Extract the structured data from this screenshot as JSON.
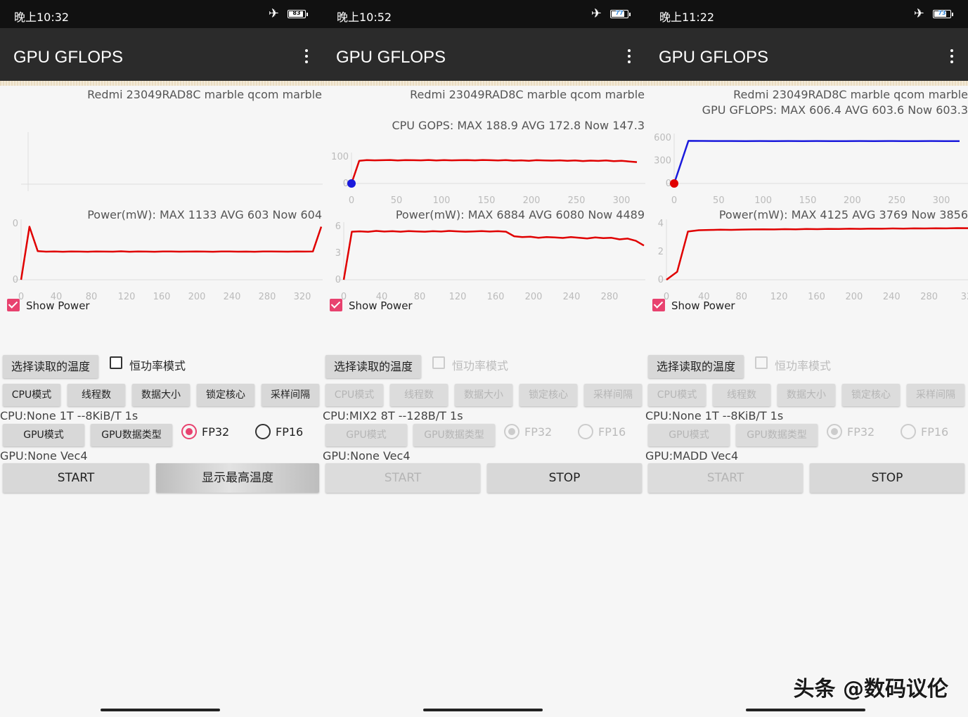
{
  "colors": {
    "accent": "#e8426f",
    "series": "#e00000",
    "gpu_series": "#1a1adc",
    "start_point": "#1a1adc"
  },
  "watermark": "头条 @数码议伦",
  "panels": [
    {
      "status_time": "晚上10:32",
      "battery": "83",
      "battery_level": 0.83,
      "charging": false,
      "title": "GPU GFLOPS",
      "device": "Redmi 23049RAD8C marble qcom marble",
      "perf_label": "",
      "perf_chart": {
        "type": "line",
        "y_ticks": [],
        "x_ticks": [],
        "values": []
      },
      "power_label": "Power(mW): MAX 1133 AVG 603 Now 604",
      "power_chart": {
        "type": "line",
        "y_ticks": [
          "0",
          "0"
        ],
        "x_ticks": [
          "0",
          "40",
          "80",
          "120",
          "160",
          "200",
          "240",
          "280",
          "320"
        ],
        "x_max": 340,
        "y_max": 1200,
        "values": [
          0,
          1133,
          610,
          600,
          603,
          598,
          605,
          601,
          599,
          604,
          602,
          600,
          607,
          598,
          603,
          601,
          599,
          605,
          603,
          600,
          602,
          604,
          601,
          599,
          603,
          605,
          600,
          602,
          598,
          604,
          603,
          601,
          600,
          605,
          602,
          604,
          1133
        ]
      },
      "show_power_label": "Show Power",
      "temp_button": "选择读取的温度",
      "const_power_label": "恒功率模式",
      "mode_buttons": [
        "CPU模式",
        "线程数",
        "数据大小",
        "锁定核心",
        "采样间隔"
      ],
      "cpu_info": "CPU:None 1T --8KiB/T 1s",
      "gpu_mode_button": "GPU模式",
      "gpu_type_button": "GPU数据类型",
      "fp32_label": "FP32",
      "fp16_label": "FP16",
      "gpu_info": "GPU:None Vec4",
      "start_button": "START",
      "second_button": "显示最高温度",
      "controls_disabled": false
    },
    {
      "status_time": "晚上10:52",
      "battery": "77",
      "battery_level": 0.77,
      "charging": true,
      "title": "GPU GFLOPS",
      "device": "Redmi 23049RAD8C marble qcom marble",
      "perf_label": "CPU GOPS: MAX 188.9 AVG 172.8 Now 147.3",
      "perf_chart": {
        "type": "line",
        "y_ticks": [
          "100",
          "0"
        ],
        "x_ticks": [
          "0",
          "50",
          "100",
          "150",
          "200",
          "250",
          "300"
        ],
        "x_max": 320,
        "y_max": 200,
        "values": [
          0,
          170,
          175,
          173,
          174,
          176,
          172,
          175,
          174,
          173,
          176,
          172,
          175,
          173,
          174,
          175,
          173,
          176,
          174,
          172,
          175,
          171,
          173,
          170,
          174,
          172,
          171,
          173,
          170,
          172,
          168,
          171,
          169,
          172,
          167,
          170,
          165,
          160
        ]
      },
      "power_label": "Power(mW): MAX 6884 AVG 6080 Now 4489",
      "power_chart": {
        "type": "line",
        "y_ticks": [
          "6",
          "3",
          "0"
        ],
        "x_ticks": [
          "0",
          "40",
          "80",
          "120",
          "160",
          "200",
          "240",
          "280"
        ],
        "x_max": 320,
        "y_max": 7000,
        "values": [
          0,
          6300,
          6350,
          6280,
          6400,
          6320,
          6360,
          6300,
          6380,
          6340,
          6300,
          6360,
          6320,
          6400,
          6350,
          6300,
          6340,
          6380,
          6320,
          6360,
          6300,
          5700,
          5600,
          5650,
          5500,
          5600,
          5550,
          5480,
          5600,
          5500,
          5420,
          5550,
          5450,
          5500,
          5300,
          5400,
          5100,
          4489
        ]
      },
      "show_power_label": "Show Power",
      "temp_button": "选择读取的温度",
      "const_power_label": "恒功率模式",
      "mode_buttons": [
        "CPU模式",
        "线程数",
        "数据大小",
        "锁定核心",
        "采样间隔"
      ],
      "cpu_info": "CPU:MIX2 8T --128B/T 1s",
      "gpu_mode_button": "GPU模式",
      "gpu_type_button": "GPU数据类型",
      "fp32_label": "FP32",
      "fp16_label": "FP16",
      "gpu_info": "GPU:None Vec4",
      "start_button": "START",
      "second_button": "STOP",
      "controls_disabled": true
    },
    {
      "status_time": "晚上11:22",
      "battery": "73",
      "battery_level": 0.73,
      "charging": true,
      "title": "GPU GFLOPS",
      "device": "Redmi 23049RAD8C marble qcom marble",
      "perf_label": "GPU GFLOPS: MAX 606.4 AVG 603.6 Now 603.3",
      "perf_chart": {
        "type": "line",
        "y_ticks": [
          "600",
          "300",
          "0"
        ],
        "x_ticks": [
          "0",
          "50",
          "100",
          "150",
          "200",
          "250",
          "300"
        ],
        "x_max": 320,
        "y_max": 650,
        "values": [
          0,
          606,
          605,
          604,
          604,
          603,
          604,
          603,
          604,
          603,
          604,
          603,
          603,
          604,
          603,
          604,
          603,
          603,
          604,
          603,
          603
        ]
      },
      "power_label": "Power(mW): MAX 4125 AVG 3769 Now 3856",
      "power_chart": {
        "type": "line",
        "y_ticks": [
          "4",
          "2",
          "0"
        ],
        "x_ticks": [
          "0",
          "40",
          "80",
          "120",
          "160",
          "200",
          "240",
          "280",
          "32"
        ],
        "x_max": 320,
        "y_max": 4200,
        "values": [
          0,
          600,
          3600,
          3700,
          3720,
          3740,
          3730,
          3750,
          3760,
          3770,
          3760,
          3780,
          3770,
          3790,
          3780,
          3800,
          3790,
          3810,
          3800,
          3820,
          3810,
          3830,
          3820,
          3840,
          3830,
          3850,
          3840,
          3860,
          3856
        ]
      },
      "show_power_label": "Show Power",
      "temp_button": "选择读取的温度",
      "const_power_label": "恒功率模式",
      "mode_buttons": [
        "CPU模式",
        "线程数",
        "数据大小",
        "锁定核心",
        "采样间隔"
      ],
      "cpu_info": "CPU:None 1T --8KiB/T 1s",
      "gpu_mode_button": "GPU模式",
      "gpu_type_button": "GPU数据类型",
      "fp32_label": "FP32",
      "fp16_label": "FP16",
      "gpu_info": "GPU:MADD Vec4",
      "start_button": "START",
      "second_button": "STOP",
      "controls_disabled": true
    }
  ]
}
